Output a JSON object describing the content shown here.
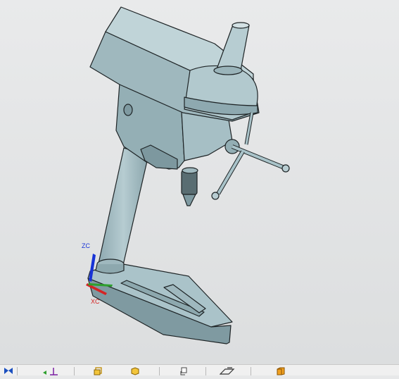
{
  "viewport": {
    "axis_labels": {
      "z": "ZC",
      "x": "XC"
    },
    "colors": {
      "background": "#e2e3e4",
      "model_fill": "#a9c3c9",
      "model_light": "#c3d6da",
      "model_dark": "#7f9aa1",
      "outline": "#1e2426",
      "axis_z": "#1733d6",
      "axis_x": "#d42424",
      "axis_y": "#2ea02e"
    }
  },
  "toolbar": {
    "buttons": [
      {
        "icon": "fit-view-icon"
      },
      {
        "icon": "wcs-origin-icon"
      },
      {
        "icon": "wireframe-cube-icon"
      },
      {
        "icon": "shaded-cube-icon"
      },
      {
        "icon": "section-view-icon"
      },
      {
        "icon": "sketch-plane-icon"
      },
      {
        "icon": "solid-box-icon"
      }
    ]
  }
}
